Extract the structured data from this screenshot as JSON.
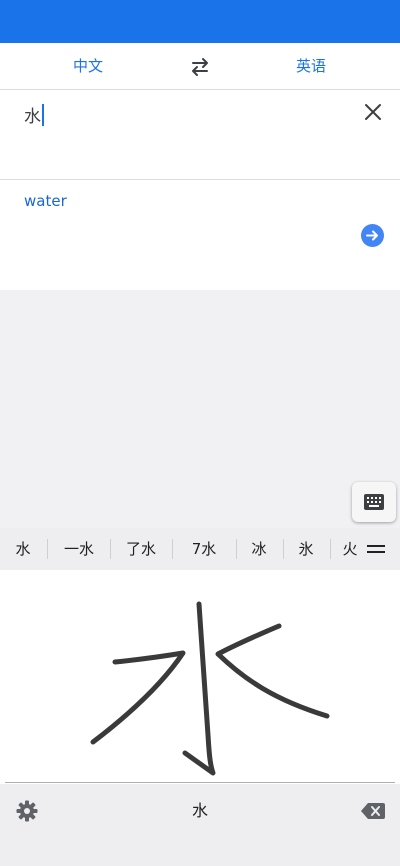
{
  "lang_bar": {
    "source_language": "中文",
    "target_language": "英语",
    "swap_icon": "swap-arrows-icon"
  },
  "input": {
    "text": "水",
    "clear_icon": "close-icon"
  },
  "result": {
    "translation": "water",
    "go_icon": "arrow-right-icon"
  },
  "keyboard_toggle_icon": "keyboard-icon",
  "candidates": [
    "水",
    "一水",
    "了水",
    "7水",
    "冰",
    "氷",
    "火"
  ],
  "candidates_more_icon": "menu-icon",
  "handwriting_pad": {
    "strokes": "handwritten character 水"
  },
  "bottom_bar": {
    "settings_icon": "gear-icon",
    "center_label": "水",
    "backspace_icon": "backspace-icon"
  },
  "colors": {
    "accent": "#1a73e8",
    "status_bar": "#1a73e8",
    "ink": "#3a3a3a"
  }
}
